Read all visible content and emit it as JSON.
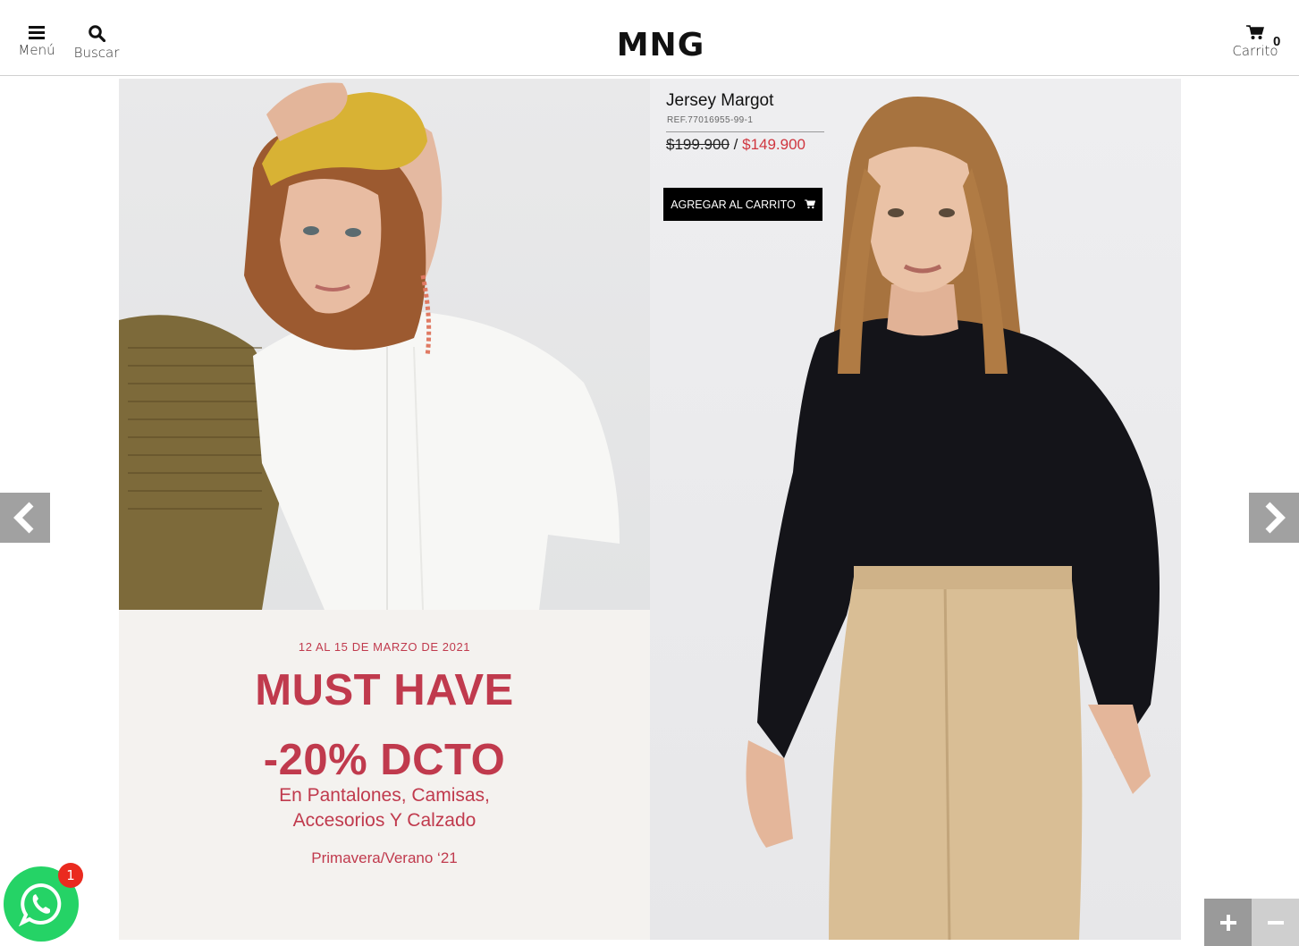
{
  "header": {
    "menu_label": "Menú",
    "search_label": "Buscar",
    "logo_text": "MNG",
    "cart_label": "Carrito",
    "cart_count": "0"
  },
  "promo": {
    "date": "12 AL 15 DE MARZO DE 2021",
    "headline_1": "MUST HAVE",
    "headline_2": "-20% DCTO",
    "sub_1": "En Pantalones, Camisas,",
    "sub_2": "Accesorios Y Calzado",
    "season": "Primavera/Verano ‘21"
  },
  "product": {
    "name": "Jersey Margot",
    "ref": "REF.77016955-99-1",
    "old_price": "$199.900",
    "separator": "/",
    "new_price": "$149.900",
    "add_to_cart_label": "AGREGAR AL CARRITO"
  },
  "whatsapp": {
    "badge_count": "1"
  },
  "colors": {
    "promo_red": "#c03a4d",
    "price_red": "#d0363f",
    "whatsapp_green": "#25d366",
    "badge_red": "#ea2a1f"
  },
  "icons": [
    "menu-icon",
    "search-icon",
    "cart-icon",
    "prev-arrow-icon",
    "next-arrow-icon",
    "zoom-in-icon",
    "zoom-out-icon",
    "whatsapp-icon"
  ]
}
